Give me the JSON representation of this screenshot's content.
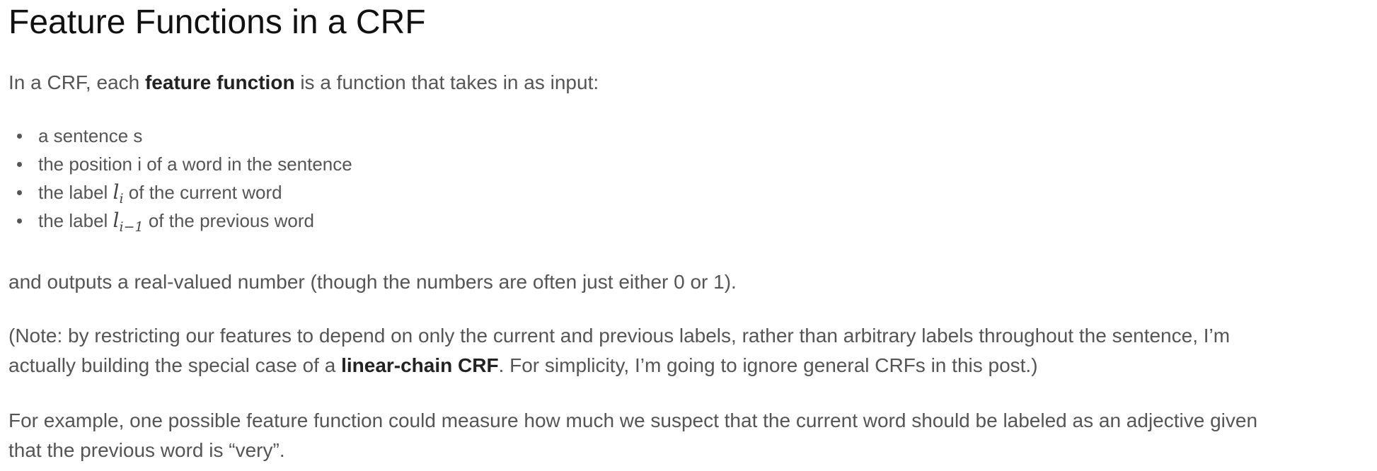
{
  "heading": "Feature Functions in a CRF",
  "intro": {
    "before": "In a CRF, each ",
    "bold": "feature function",
    "after": " is a function that takes in as input:"
  },
  "inputs": [
    {
      "text": "a sentence s"
    },
    {
      "text": "the position i of a word in the sentence"
    },
    {
      "before": "the label ",
      "math_var": "l",
      "math_sub": "i",
      "after": " of the current word"
    },
    {
      "before": "the label ",
      "math_var": "l",
      "math_sub": "i−1",
      "after": " of the previous word"
    }
  ],
  "outputs": "and outputs a real-valued number (though the numbers are often just either 0 or 1).",
  "note": {
    "line1": "(Note: by restricting our features to depend on only the current and previous labels, rather than arbitrary labels throughout the sentence, I’m",
    "line2_before": "actually building the special case of a ",
    "line2_bold": "linear-chain CRF",
    "line2_after": ". For simplicity, I’m going to ignore general CRFs in this post.)"
  },
  "example": {
    "line1": "For example, one possible feature function could measure how much we suspect that the current word should be labeled as an adjective given",
    "line2": "that the previous word is “very”."
  }
}
